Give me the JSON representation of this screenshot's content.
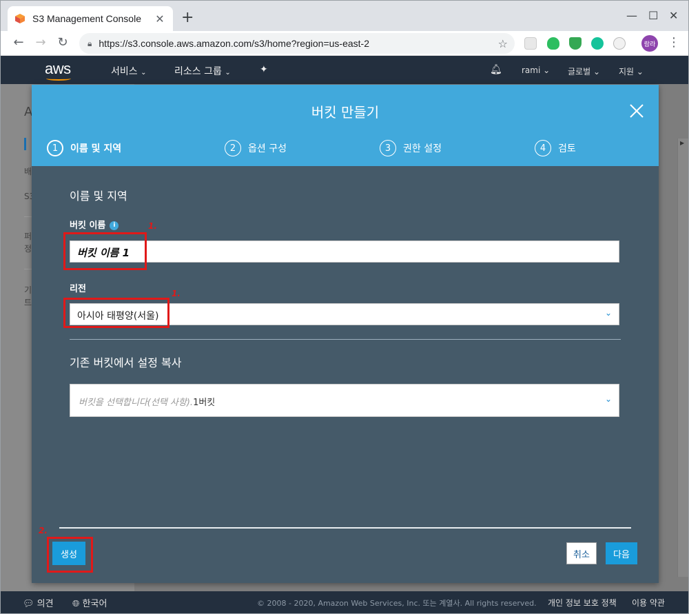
{
  "browser": {
    "tab_title": "S3 Management Console",
    "tab_close": "✕",
    "new_tab": "+",
    "url": "https://s3.console.aws.amazon.com/s3/home?region=us-east-2",
    "profile_label": "람라",
    "window_min": "—",
    "window_max": "☐",
    "window_close": "✕"
  },
  "aws_nav": {
    "logo": "aws",
    "services": "서비스",
    "resource_groups": "리소스 그룹",
    "user": "rami",
    "region": "글로벌",
    "support": "지원"
  },
  "background_page": {
    "letters": [
      "A",
      "배",
      "S3",
      "퍼",
      "정",
      "기",
      "트"
    ]
  },
  "modal": {
    "title": "버킷 만들기",
    "steps": [
      {
        "number": "1",
        "label": "이름 및 지역"
      },
      {
        "number": "2",
        "label": "옵션 구성"
      },
      {
        "number": "3",
        "label": "권한 설정"
      },
      {
        "number": "4",
        "label": "검토"
      }
    ],
    "section_title": "이름 및 지역",
    "bucket_name_label": "버킷 이름",
    "bucket_name_value": "버킷 이름 1",
    "region_label": "리전",
    "region_value": "아시아 태평양(서울)",
    "copy_section_title": "기존 버킷에서 설정 복사",
    "copy_placeholder": "버킷을 선택합니다(선택 사항).",
    "copy_suffix": "1버킷",
    "create_button": "생성",
    "cancel_button": "취소",
    "next_button": "다음"
  },
  "annotations": {
    "marker_1": "1.",
    "marker_2": "2.",
    "color": "#e01919"
  },
  "footer": {
    "feedback": "의견",
    "language": "한국어",
    "copyright": "© 2008 - 2020, Amazon Web Services, Inc. 또는 계열사. All rights reserved.",
    "privacy": "개인 정보 보호 정책",
    "terms": "이용 약관"
  },
  "colors": {
    "modal_header": "#41a9dc",
    "modal_body": "#455a69",
    "aws_nav": "#232f3e",
    "primary_button": "#1a9cdb"
  }
}
